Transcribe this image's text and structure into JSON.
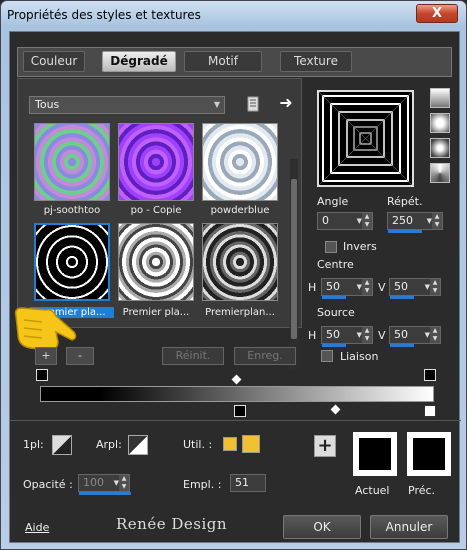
{
  "window": {
    "title": "Propriétés des styles et textures",
    "close_glyph": "X"
  },
  "tabs": [
    {
      "label": "Couleur",
      "active": false
    },
    {
      "label": "Dégradé",
      "active": true
    },
    {
      "label": "Motif",
      "active": false
    },
    {
      "label": "Texture",
      "active": false
    }
  ],
  "category_dropdown": {
    "value": "Tous"
  },
  "thumbnails": [
    {
      "label": "pj-soothtoo",
      "selected": false
    },
    {
      "label": "po - Copie",
      "selected": false
    },
    {
      "label": "powderblue",
      "selected": false
    },
    {
      "label": "premier pla...",
      "selected": true
    },
    {
      "label": "Premier pla...",
      "selected": false
    },
    {
      "label": "Premierplan...",
      "selected": false
    }
  ],
  "gradient_buttons": {
    "add": "+",
    "remove": "-",
    "reset": "Réinit.",
    "save": "Enreg."
  },
  "angle": {
    "label": "Angle",
    "value": "0"
  },
  "repeat": {
    "label": "Répét.",
    "value": "250"
  },
  "invert": {
    "label": "Invers"
  },
  "center": {
    "label": "Centre",
    "h_label": "H",
    "h_value": "50",
    "v_label": "V",
    "v_value": "50"
  },
  "source": {
    "label": "Source",
    "h_label": "H",
    "h_value": "50",
    "v_label": "V",
    "v_value": "50"
  },
  "link": {
    "label": "Liaison"
  },
  "bottom": {
    "first_plane_label": "1pl:",
    "back_plane_label": "Arpl:",
    "util_label": "Util. :",
    "opacity_label": "Opacité :",
    "opacity_value": "100",
    "location_label": "Empl. :",
    "location_value": "51",
    "current_label": "Actuel",
    "previous_label": "Préc."
  },
  "footer": {
    "help_label": "Aide",
    "logo_text": "Renée Design",
    "ok_label": "OK",
    "cancel_label": "Annuler"
  },
  "colors": {
    "accent": "#1e7fd8",
    "swatch": "#f0c030",
    "background": "#2b2b2b"
  }
}
